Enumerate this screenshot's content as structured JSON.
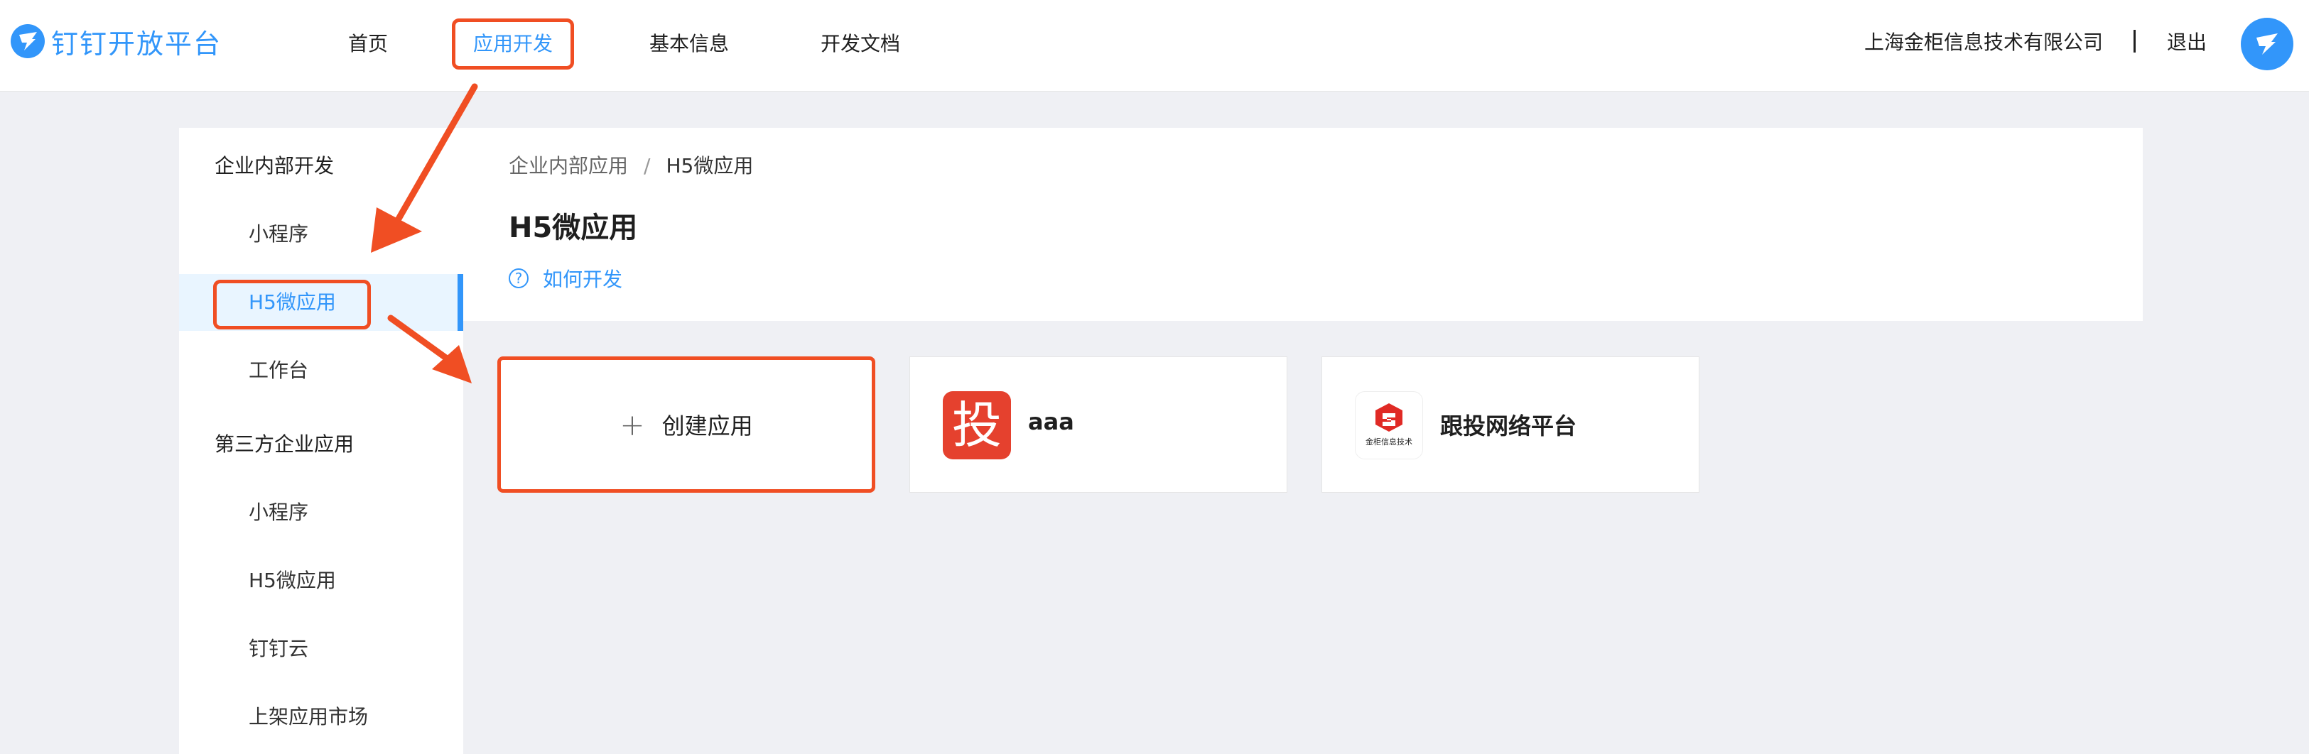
{
  "header": {
    "brand": "钉钉开放平台",
    "nav": [
      "首页",
      "应用开发",
      "基本信息",
      "开发文档"
    ],
    "company": "上海金柜信息技术有限公司",
    "logout": "退出"
  },
  "sidebar": {
    "group1": "企业内部开发",
    "group1_items": [
      "小程序",
      "H5微应用",
      "工作台"
    ],
    "group2": "第三方企业应用",
    "group2_items": [
      "小程序",
      "H5微应用",
      "钉钉云",
      "上架应用市场"
    ]
  },
  "main": {
    "breadcrumb": [
      "企业内部应用",
      "/",
      "H5微应用"
    ],
    "title": "H5微应用",
    "howto": "如何开发",
    "create_label": "创建应用",
    "apps": [
      {
        "icon_text": "投",
        "name": "aaa"
      },
      {
        "icon_text": "金柜信息技术",
        "name": "跟投网络平台"
      }
    ]
  },
  "colors": {
    "accent": "#3296fa",
    "annotation": "#f04e23"
  },
  "icons": [
    "dingtalk-logo-icon",
    "help-circle-icon",
    "plus-icon"
  ]
}
